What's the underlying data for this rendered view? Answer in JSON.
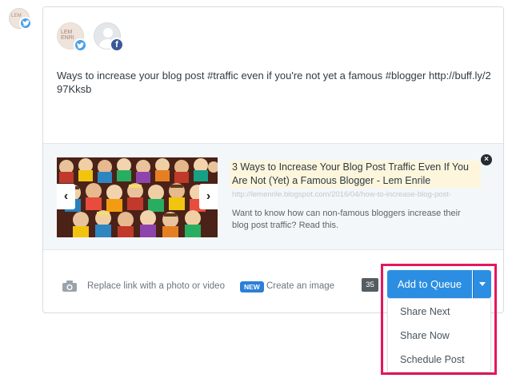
{
  "composer": {
    "post_text": "Ways to increase your blog post #traffic even if you're not yet a famous #blogger http://buff.ly/297Kksb",
    "avatar_text": "LEM ENRI"
  },
  "link_preview": {
    "title": "3 Ways to Increase Your Blog Post Traffic Even If You Are Not (Yet) a Famous Blogger - Lem Enrile",
    "url": "http://lemenrile.blogspot.com/2016/04/how-to-increase-blog-post-",
    "description": "Want to know how can non-famous bloggers increase their blog post traffic? Read this.",
    "prev_glyph": "‹",
    "next_glyph": "›",
    "close_glyph": "×"
  },
  "footer": {
    "replace_link": "Replace link with a photo or video",
    "new_badge": "NEW",
    "create_image": "Create an image",
    "char_count": "35"
  },
  "actions": {
    "primary_label": "Add to Queue",
    "menu": [
      "Share Next",
      "Share Now",
      "Schedule Post"
    ]
  },
  "icons": {
    "twitter": "twitter-icon",
    "facebook": "facebook-icon",
    "camera": "camera-icon",
    "close": "close-icon"
  },
  "colors": {
    "primary": "#2c8ee3",
    "highlight": "#e5175c",
    "twitter": "#4a9fe8",
    "facebook": "#3b5998"
  }
}
